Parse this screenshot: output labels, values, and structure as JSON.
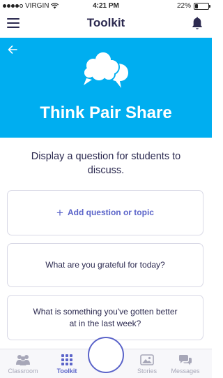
{
  "status_bar": {
    "carrier": "VIRGIN",
    "time": "4:21 PM",
    "battery": "22%",
    "battery_level": 0.22
  },
  "header": {
    "title": "Toolkit",
    "menu_icon": "hamburger-menu-icon",
    "notification_icon": "bell-icon"
  },
  "hero": {
    "back_icon": "arrow-left-icon",
    "illustration_icon": "speech-bubbles-icon",
    "title": "Think Pair Share",
    "background_color": "#00aef0"
  },
  "main": {
    "prompt": "Display a question for students to discuss.",
    "add_label": "Add question or topic",
    "questions": [
      "What are you grateful for today?",
      "What is something you've gotten better at in the last week?"
    ]
  },
  "tabbar": {
    "tabs": [
      {
        "label": "Classroom",
        "icon": "classroom-icon",
        "active": false
      },
      {
        "label": "Toolkit",
        "icon": "grid-icon",
        "active": true
      },
      {
        "label": "Stories",
        "icon": "stories-icon",
        "active": false
      },
      {
        "label": "Messages",
        "icon": "messages-icon",
        "active": false
      }
    ],
    "accent_color": "#5b64c9"
  }
}
